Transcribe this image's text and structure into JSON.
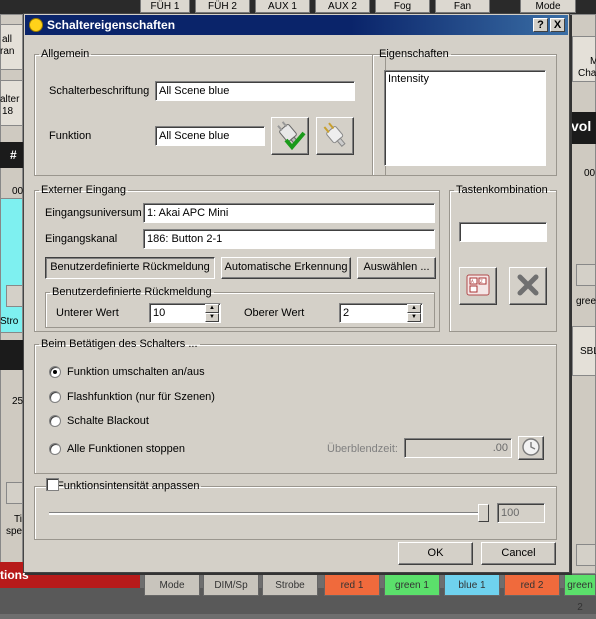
{
  "background": {
    "tabs": [
      "FÜH 1",
      "FÜH 2",
      "AUX 1",
      "AUX 2",
      "Fog",
      "Fan",
      "Mode"
    ],
    "left": {
      "all_line1": "all",
      "all_line2": "ran",
      "slter_line1": "alter",
      "slter_line2": "18",
      "hash": "#",
      "val1": "00",
      "stro": "Stro",
      "val2": "25",
      "ti": "Ti",
      "spe": "spe",
      "footer_label": "tions"
    },
    "right": {
      "m": "M",
      "cha": "Cha",
      "vol": "vol",
      "val": "00",
      "gree": "gree",
      "sbl": "SBL"
    },
    "bottom_buttons": [
      {
        "label": "Mode",
        "color": "#c8c4bc"
      },
      {
        "label": "DIM/Sp",
        "color": "#c8c4bc"
      },
      {
        "label": "Strobe",
        "color": "#c8c4bc"
      },
      {
        "label": "red 1",
        "color": "#f06a3c"
      },
      {
        "label": "green 1",
        "color": "#5be06b"
      },
      {
        "label": "blue 1",
        "color": "#6fd2ee"
      },
      {
        "label": "red 2",
        "color": "#f06a3c"
      },
      {
        "label": "green 2",
        "color": "#5be06b"
      }
    ]
  },
  "dialog": {
    "title": "Schaltereigenschaften",
    "help_button": "?",
    "close_button": "X",
    "general": {
      "legend": "Allgemein",
      "caption_label": "Schalterbeschriftung",
      "caption_value": "All Scene blue",
      "function_label": "Funktion",
      "function_value": "All Scene blue"
    },
    "properties": {
      "legend": "Eigenschaften",
      "items": [
        "Intensity"
      ]
    },
    "external": {
      "legend": "Externer Eingang",
      "universe_label": "Eingangsuniversum",
      "universe_value": "1: Akai APC Mini",
      "channel_label": "Eingangskanal",
      "channel_value": "186: Button 2-1",
      "custom_feedback_button": "Benutzerdefinierte Rückmeldung",
      "auto_detect_button": "Automatische Erkennung",
      "choose_button": "Auswählen ...",
      "feedback": {
        "legend": "Benutzerdefinierte Rückmeldung",
        "lower_label": "Unterer Wert",
        "lower_value": "10",
        "upper_label": "Oberer Wert",
        "upper_value": "2"
      }
    },
    "key_combo": {
      "legend": "Tastenkombination",
      "value": ""
    },
    "press": {
      "legend": "Beim Betätigen des Schalters ...",
      "options": [
        "Funktion umschalten an/aus",
        "Flashfunktion (nur für Szenen)",
        "Schalte Blackout",
        "Alle Funktionen stoppen"
      ],
      "selected_index": 0,
      "fade_label": "Überblendzeit:",
      "fade_value": ".00"
    },
    "intensity": {
      "legend": "Funktionsintensität anpassen",
      "checked": false,
      "level": 100,
      "value": "100"
    },
    "ok_button": "OK",
    "cancel_button": "Cancel"
  }
}
